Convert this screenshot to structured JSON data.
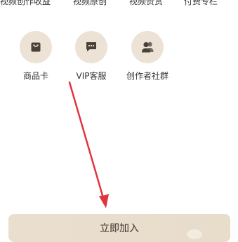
{
  "top_row": {
    "items": [
      "视频创作收益",
      "视频原创",
      "视频赞赏",
      "付费专栏"
    ]
  },
  "features": [
    {
      "label": "商品卡",
      "icon": "shopping-bag-icon"
    },
    {
      "label": "VIP客服",
      "icon": "chat-bubble-icon"
    },
    {
      "label": "创作者社群",
      "icon": "users-group-icon"
    }
  ],
  "join": {
    "label": "立即加入"
  },
  "colors": {
    "icon_bg": "#ece3d6",
    "icon_fg": "#4a4036",
    "arrow": "#e0353f",
    "join_bg": "#e9ddcc"
  }
}
